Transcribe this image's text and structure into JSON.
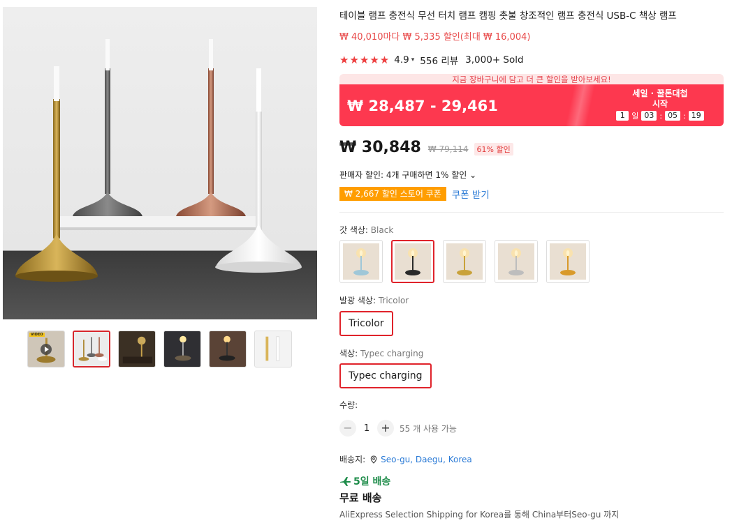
{
  "product": {
    "title": "테이블 램프 충전식 무선 터치 램프 캠핑 촛불 창조적인 램프 충전식 USB-C 책상 램프",
    "promo_line": "₩ 40,010마다 ₩ 5,335 할인(최대 ₩ 16,004)",
    "stars": "★★★★★",
    "rating": "4.9",
    "reviews": "556 리뷰",
    "sold": "3,000+ Sold"
  },
  "deal": {
    "cart_banner": "지금 장바구니에 담고 더 큰 할인을 받아보세요!",
    "price_range": "₩ 28,487 - 29,461",
    "label_line1": "세일 · 꿀톤대첩",
    "label_line2": "시작",
    "countdown": {
      "days": "1",
      "days_unit": "일",
      "hours": "03",
      "minutes": "05",
      "seconds": "19",
      "sep": ":"
    }
  },
  "price": {
    "current": "₩ 30,848",
    "original": "₩ 79,114",
    "discount": "61% 할인"
  },
  "seller_discount": "판매자 할인: 4개 구매하면 1% 할인 ⌄",
  "coupon": {
    "tag": "₩ 2,667 할인 스토어 쿠폰",
    "link": "쿠폰 받기"
  },
  "options": {
    "color": {
      "label": "갓 색상: ",
      "value": "Black"
    },
    "swatch_colors": [
      "#9fc7d8",
      "#2a2a2a",
      "#c9a23a",
      "#bdbdbd",
      "#d99a2a"
    ],
    "light": {
      "label": "발광 색상: ",
      "value": "Tricolor",
      "button": "Tricolor"
    },
    "charging": {
      "label": "색상: ",
      "value": "Typec charging",
      "button": "Typec charging"
    }
  },
  "quantity": {
    "label": "수량:",
    "minus": "−",
    "value": "1",
    "plus": "+",
    "available": "55 개 사용 가능"
  },
  "shipping": {
    "label": "배송지:",
    "location": "Seo-gu, Daegu, Korea",
    "delivery": "5일 배송",
    "free": "무료 배송",
    "description": "AliExpress Selection Shipping for Korea를 통해 China부터Seo-gu 까지"
  },
  "gallery": {
    "video_tag": "VIDEO"
  },
  "colors": {
    "accent_red": "#fd384f",
    "link_blue": "#2a7ad6",
    "coupon_orange": "#ff9d00",
    "delivery_green": "#1e8c4a"
  }
}
